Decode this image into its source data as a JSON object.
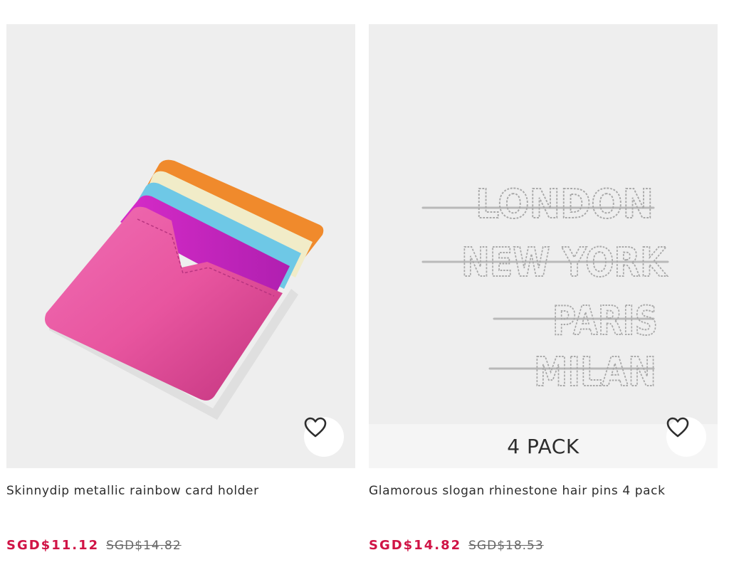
{
  "products": [
    {
      "title": "Skinnydip metallic rainbow card holder",
      "sale_price": "SGD$11.12",
      "original_price": "SGD$14.82",
      "image_subject": "rainbow-card-holder",
      "save_icon": "heart-icon"
    },
    {
      "title": "Glamorous slogan rhinestone hair pins 4 pack",
      "sale_price": "SGD$14.82",
      "original_price": "SGD$18.53",
      "image_subject": "rhinestone-hair-pins",
      "banner": "4 PACK",
      "pin_words": [
        "LONDON",
        "NEW YORK",
        "PARIS",
        "MILAN"
      ],
      "save_icon": "heart-icon"
    }
  ],
  "colors": {
    "sale_price": "#d01345",
    "text": "#2d2d2d",
    "image_bg": "#eeeeee"
  }
}
